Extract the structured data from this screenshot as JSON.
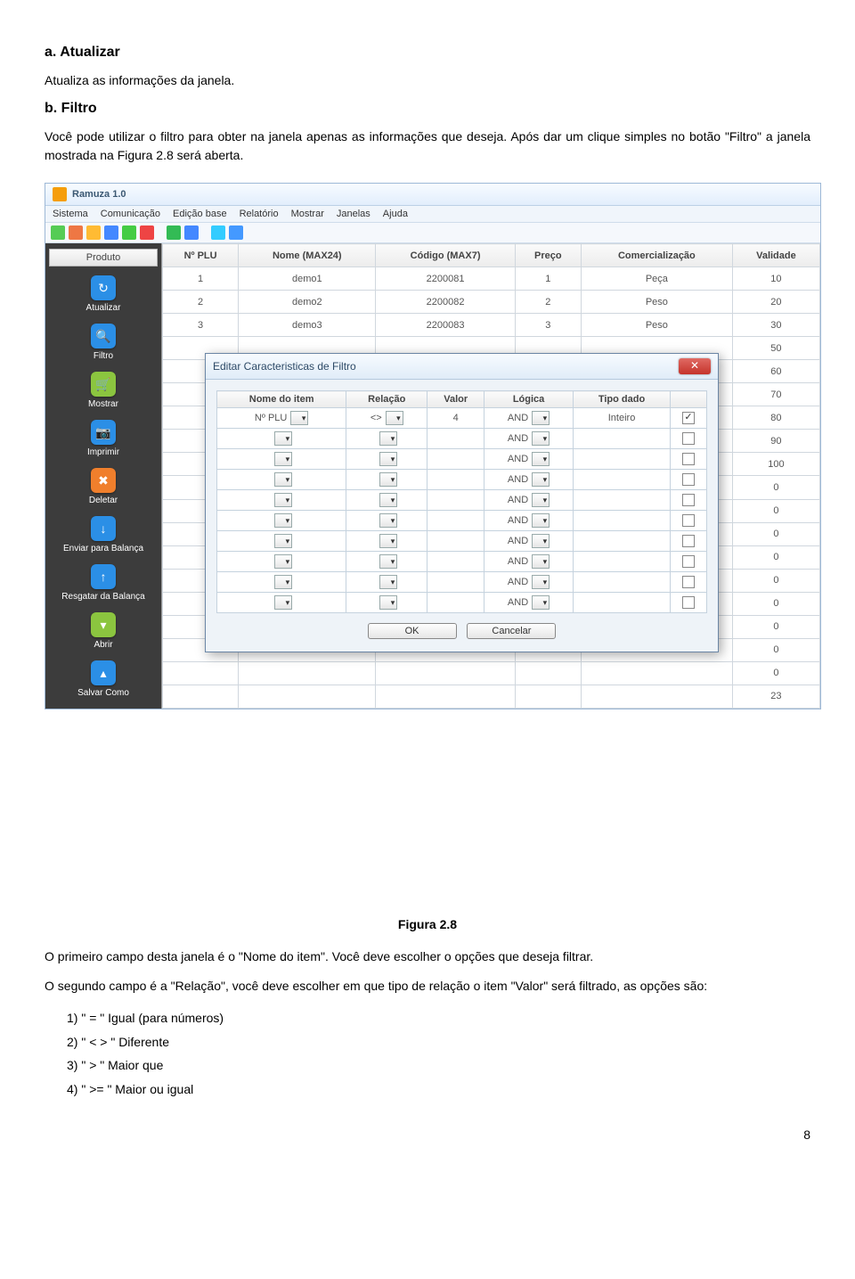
{
  "doc": {
    "section_a_title": "a. Atualizar",
    "section_a_text": "Atualiza as informações da janela.",
    "section_b_title": "b. Filtro",
    "section_b_text": "Você pode utilizar o filtro para obter na janela apenas as informações que deseja. Após dar um clique simples no botão \"Filtro\" a janela mostrada na Figura 2.8 será aberta.",
    "figure_caption": "Figura 2.8",
    "after1_text": "O primeiro campo desta janela é o \"Nome do item\". Você deve escolher o opções que deseja filtrar.",
    "after2_text": "O segundo campo é a \"Relação\", você deve escolher em que tipo de relação o item \"Valor\" será filtrado, as opções são:",
    "options": {
      "o1": "1) \" = \"   Igual (para números)",
      "o2": "2) \" < > \"   Diferente",
      "o3": "3) \" > \"   Maior que",
      "o4": "4) \" >= \"   Maior ou igual"
    },
    "page_number": "8"
  },
  "app": {
    "title": "Ramuza 1.0",
    "menu": [
      "Sistema",
      "Comunicação",
      "Edição base",
      "Relatório",
      "Mostrar",
      "Janelas",
      "Ajuda"
    ],
    "sidebar_header": "Produto",
    "sidebar": [
      {
        "label": "Atualizar",
        "color": "#2b8fe6",
        "glyph": "↻"
      },
      {
        "label": "Filtro",
        "color": "#2b8fe6",
        "glyph": "🔍"
      },
      {
        "label": "Mostrar",
        "color": "#8bc53f",
        "glyph": "🛒"
      },
      {
        "label": "Imprimir",
        "color": "#2b8fe6",
        "glyph": "📷"
      },
      {
        "label": "Deletar",
        "color": "#f07f2c",
        "glyph": "✖"
      },
      {
        "label": "Enviar para Balança",
        "color": "#2b8fe6",
        "glyph": "↓"
      },
      {
        "label": "Resgatar da Balança",
        "color": "#2b8fe6",
        "glyph": "↑"
      },
      {
        "label": "Abrir",
        "color": "#8bc53f",
        "glyph": "▾"
      },
      {
        "label": "Salvar Como",
        "color": "#2b8fe6",
        "glyph": "▴"
      }
    ],
    "grid_headers": [
      "Nº PLU",
      "Nome (MAX24)",
      "Código (MAX7)",
      "Preço",
      "Comercialização",
      "Validade"
    ],
    "grid_rows": [
      [
        "1",
        "demo1",
        "2200081",
        "1",
        "Peça",
        "10"
      ],
      [
        "2",
        "demo2",
        "2200082",
        "2",
        "Peso",
        "20"
      ],
      [
        "3",
        "demo3",
        "2200083",
        "3",
        "Peso",
        "30"
      ],
      [
        "",
        "",
        "",
        "",
        "",
        "50"
      ],
      [
        "",
        "",
        "",
        "",
        "",
        "60"
      ],
      [
        "",
        "",
        "",
        "",
        "",
        "70"
      ],
      [
        "",
        "",
        "",
        "",
        "",
        "80"
      ],
      [
        "",
        "",
        "",
        "",
        "",
        "90"
      ],
      [
        "",
        "",
        "",
        "",
        "",
        "100"
      ],
      [
        "",
        "",
        "",
        "",
        "",
        "0"
      ],
      [
        "",
        "",
        "",
        "",
        "",
        "0"
      ],
      [
        "",
        "",
        "",
        "",
        "",
        "0"
      ],
      [
        "",
        "",
        "",
        "",
        "",
        "0"
      ],
      [
        "",
        "",
        "",
        "",
        "",
        "0"
      ],
      [
        "",
        "",
        "",
        "",
        "",
        "0"
      ],
      [
        "",
        "",
        "",
        "",
        "",
        "0"
      ],
      [
        "",
        "",
        "",
        "",
        "",
        "0"
      ],
      [
        "",
        "",
        "",
        "",
        "",
        "0"
      ],
      [
        "",
        "",
        "",
        "",
        "",
        "23"
      ]
    ]
  },
  "dialog": {
    "title": "Editar Caracteristicas de Filtro",
    "headers": [
      "Nome do item",
      "Relação",
      "Valor",
      "Lógica",
      "Tipo dado",
      ""
    ],
    "rows": [
      {
        "item": "Nº PLU",
        "rel": "<>",
        "valor": "4",
        "logica": "AND",
        "tipo": "Inteiro",
        "checked": true
      },
      {
        "item": "",
        "rel": "",
        "valor": "",
        "logica": "AND",
        "tipo": "",
        "checked": false
      },
      {
        "item": "",
        "rel": "",
        "valor": "",
        "logica": "AND",
        "tipo": "",
        "checked": false
      },
      {
        "item": "",
        "rel": "",
        "valor": "",
        "logica": "AND",
        "tipo": "",
        "checked": false
      },
      {
        "item": "",
        "rel": "",
        "valor": "",
        "logica": "AND",
        "tipo": "",
        "checked": false
      },
      {
        "item": "",
        "rel": "",
        "valor": "",
        "logica": "AND",
        "tipo": "",
        "checked": false
      },
      {
        "item": "",
        "rel": "",
        "valor": "",
        "logica": "AND",
        "tipo": "",
        "checked": false
      },
      {
        "item": "",
        "rel": "",
        "valor": "",
        "logica": "AND",
        "tipo": "",
        "checked": false
      },
      {
        "item": "",
        "rel": "",
        "valor": "",
        "logica": "AND",
        "tipo": "",
        "checked": false
      },
      {
        "item": "",
        "rel": "",
        "valor": "",
        "logica": "AND",
        "tipo": "",
        "checked": false
      }
    ],
    "ok_label": "OK",
    "cancel_label": "Cancelar"
  }
}
